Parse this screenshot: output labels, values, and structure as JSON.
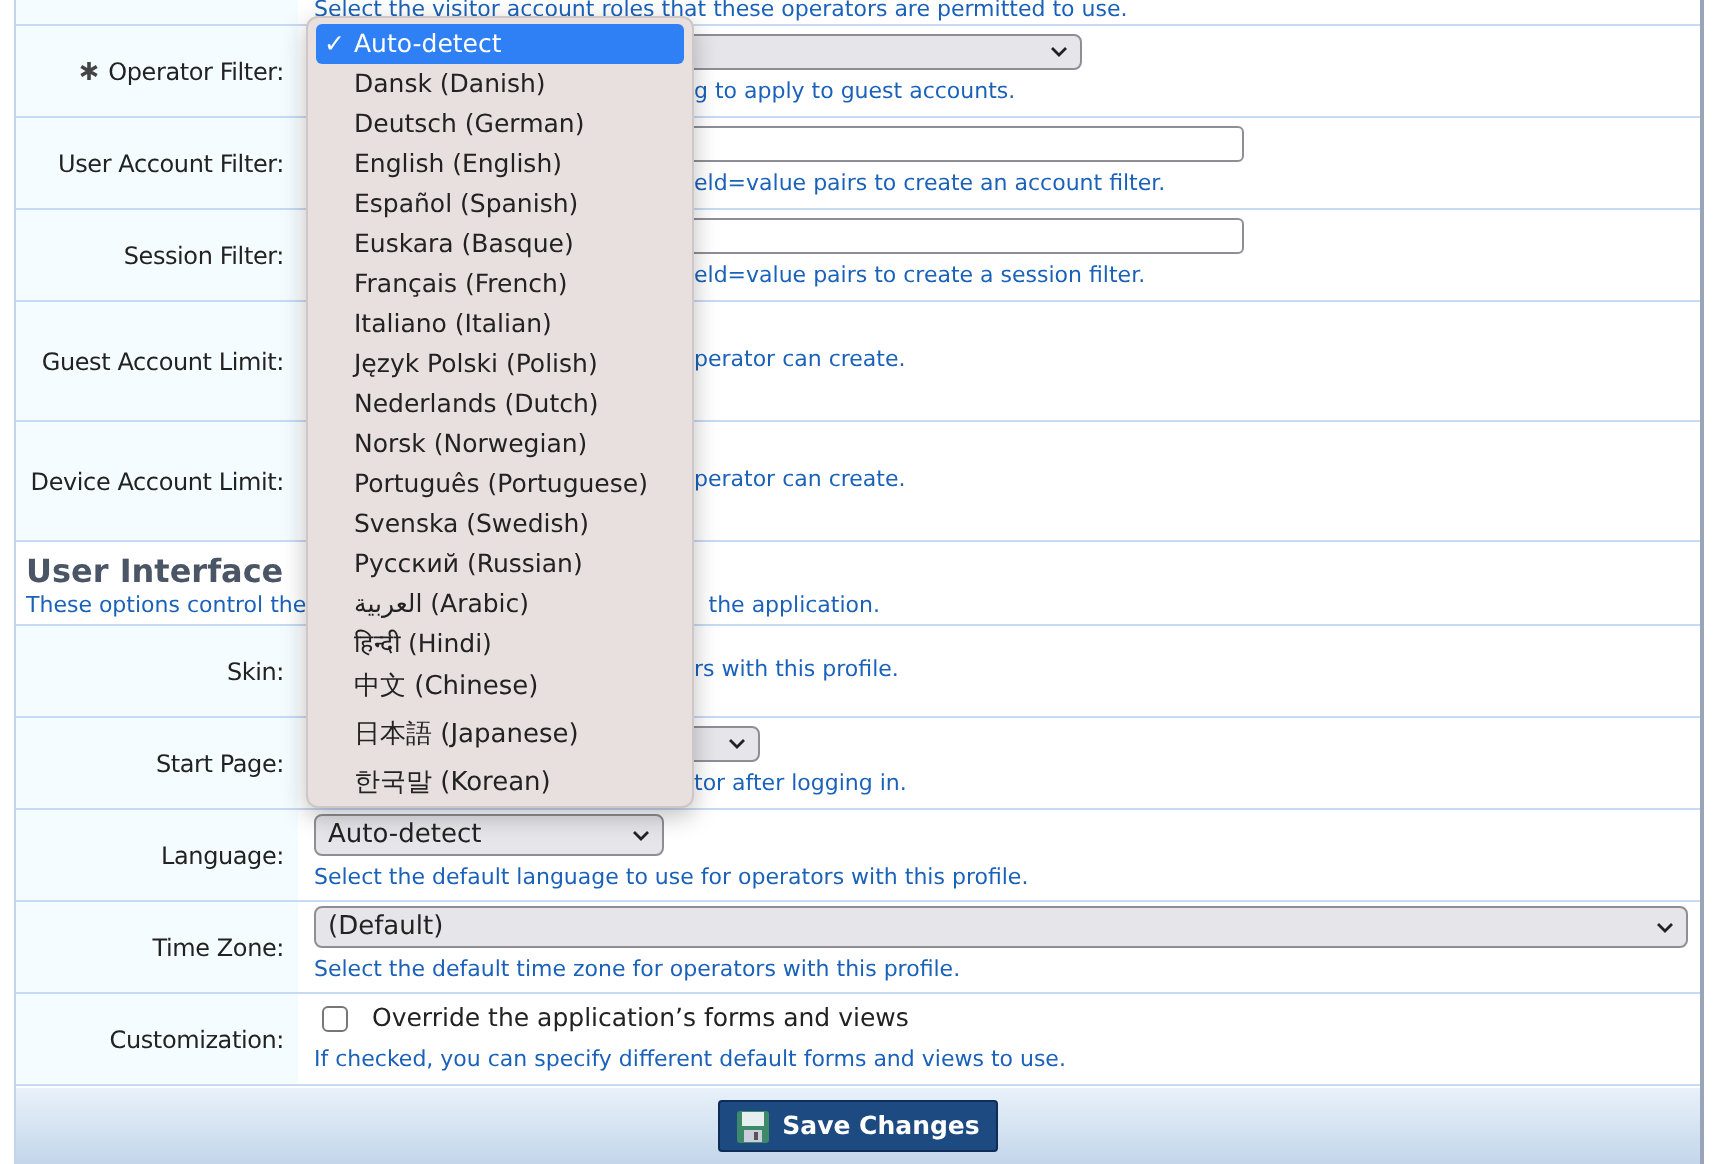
{
  "rows": [
    {
      "kind": "hint-only",
      "hint": "Select the visitor account roles that these operators are permitted to use."
    },
    {
      "kind": "field",
      "label": "Operator Filter:",
      "required": true,
      "control": {
        "kind": "select"
      },
      "hint": "g to apply to guest accounts."
    },
    {
      "kind": "field",
      "label": "User Account Filter:",
      "required": false,
      "control": {
        "kind": "input"
      },
      "hint": "eld=value pairs to create an account filter."
    },
    {
      "kind": "field",
      "label": "Session Filter:",
      "required": false,
      "control": {
        "kind": "input"
      },
      "hint": "eld=value pairs to create a session filter."
    },
    {
      "kind": "field",
      "label": "Guest Account Limit:",
      "required": false,
      "hint": "perator can create."
    },
    {
      "kind": "field",
      "label": "Device Account Limit:",
      "required": false,
      "hint": "perator can create."
    },
    {
      "kind": "section",
      "title": "User Interface",
      "parts": [
        "These options control the",
        "the application."
      ]
    },
    {
      "kind": "field",
      "label": "Skin:",
      "required": false,
      "hint": "rs with this profile."
    },
    {
      "kind": "field",
      "label": "Start Page:",
      "required": false,
      "control": {
        "kind": "select"
      },
      "hint": "tor after logging in."
    },
    {
      "kind": "field",
      "label": "Language:",
      "required": false,
      "control": {
        "kind": "select",
        "value": "Auto-detect"
      },
      "hint": "Select the default language to use for operators with this profile."
    },
    {
      "kind": "field",
      "label": "Time Zone:",
      "required": false,
      "control": {
        "kind": "select",
        "value": "(Default)"
      },
      "hint": "Select the default time zone for operators with this profile."
    },
    {
      "kind": "field",
      "label": "Customization:",
      "required": false,
      "control": {
        "kind": "checkbox",
        "checked": false,
        "text": "Override the application’s forms and views"
      },
      "hint": "If checked, you can specify different default forms and views to use."
    }
  ],
  "save_button": "Save Changes",
  "language_menu": {
    "check": "✓",
    "items": [
      {
        "label": "Auto-detect",
        "selected": true
      },
      {
        "label": "Dansk (Danish)",
        "selected": false
      },
      {
        "label": "Deutsch (German)",
        "selected": false
      },
      {
        "label": "English (English)",
        "selected": false
      },
      {
        "label": "Español (Spanish)",
        "selected": false
      },
      {
        "label": "Euskara (Basque)",
        "selected": false
      },
      {
        "label": "Français (French)",
        "selected": false
      },
      {
        "label": "Italiano (Italian)",
        "selected": false
      },
      {
        "label": "Język Polski (Polish)",
        "selected": false
      },
      {
        "label": "Nederlands (Dutch)",
        "selected": false
      },
      {
        "label": "Norsk (Norwegian)",
        "selected": false
      },
      {
        "label": "Português (Portuguese)",
        "selected": false
      },
      {
        "label": "Svenska (Swedish)",
        "selected": false
      },
      {
        "label": "Русский (Russian)",
        "selected": false
      },
      {
        "label": "العربية (Arabic)",
        "selected": false
      },
      {
        "label": "हिन्दी (Hindi)",
        "selected": false
      },
      {
        "label": "中文 (Chinese)",
        "selected": false
      },
      {
        "label": "日本語 (Japanese)",
        "selected": false
      },
      {
        "label": "한국말 (Korean)",
        "selected": false
      }
    ]
  }
}
